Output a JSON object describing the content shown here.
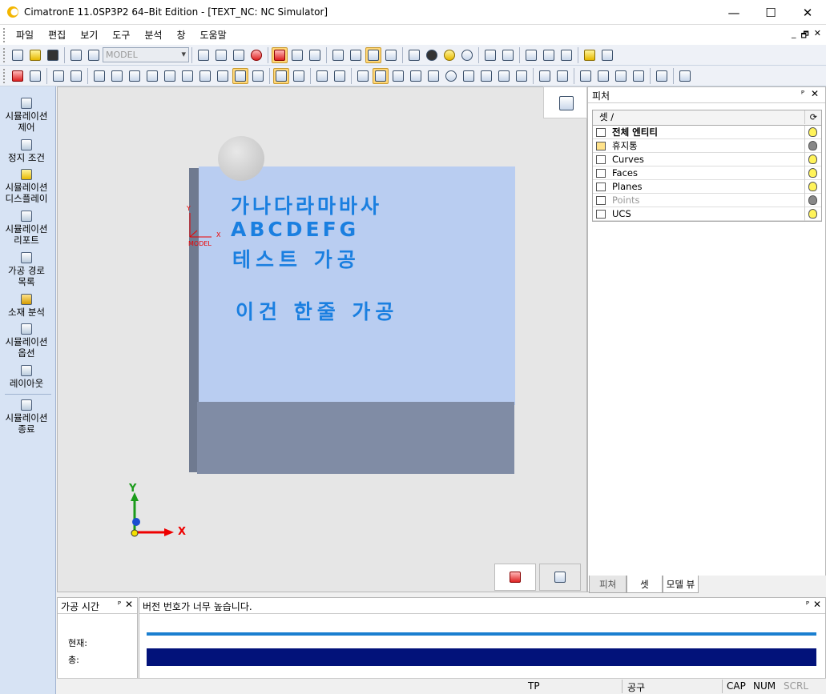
{
  "window": {
    "title": "CimatronE 11.0SP3P2 64–Bit Edition - [TEXT_NC: NC Simulator]",
    "minimize": "—",
    "maximize": "☐",
    "close": "✕"
  },
  "menu": [
    "파일",
    "편집",
    "보기",
    "도구",
    "분석",
    "창",
    "도움말"
  ],
  "mdi_controls": [
    "_",
    "🗗",
    "✕"
  ],
  "toolbar": {
    "model_combo": "MODEL"
  },
  "leftbar": {
    "items": [
      {
        "label": "시뮬레이션\n제어",
        "icon": "simulation-control-icon"
      },
      {
        "label": "정지 조건",
        "icon": "stop-condition-icon"
      },
      {
        "label": "시뮬레이션\n디스플레이",
        "icon": "simulation-display-icon"
      },
      {
        "label": "시뮬레이션\n리포트",
        "icon": "simulation-report-icon"
      },
      {
        "label": "가공 경로\n목록",
        "icon": "toolpath-list-icon"
      },
      {
        "label": "소재 분석",
        "icon": "stock-analysis-icon"
      },
      {
        "label": "시뮬레이션\n옵션",
        "icon": "simulation-options-icon"
      },
      {
        "label": "레이아웃",
        "icon": "layout-icon"
      },
      {
        "label": "시뮬레이션\n종료",
        "icon": "simulation-exit-icon"
      }
    ]
  },
  "viewport": {
    "text_lines": [
      "가나다라마바사",
      "ABCDEFG",
      "테스트 가공",
      "이건 한줄 가공"
    ],
    "ucs_label": "MODEL",
    "axis_x": "X",
    "axis_y": "Y",
    "small_axis_x": "X",
    "small_axis_y": "Y"
  },
  "right_panel": {
    "title": "피처",
    "pin": "ᴾ",
    "close": "✕",
    "column_header": "셋 /",
    "rows": [
      {
        "name": "전체 엔티티",
        "bold": true,
        "bulb": "#fff35a"
      },
      {
        "name": "휴지통",
        "bold": false,
        "bulb": "#888888"
      },
      {
        "name": "Curves",
        "bold": false,
        "bulb": "#fff35a"
      },
      {
        "name": "Faces",
        "bold": false,
        "bulb": "#fff35a"
      },
      {
        "name": "Planes",
        "bold": false,
        "bulb": "#fff35a"
      },
      {
        "name": "Points",
        "bold": false,
        "bulb": "#888888",
        "dim": true
      },
      {
        "name": "UCS",
        "bold": false,
        "bulb": "#fff35a"
      }
    ],
    "tabs": [
      "피쳐",
      "셋",
      "모델 뷰"
    ],
    "selected_tab": 1
  },
  "bottom": {
    "left_title": "가공 시간",
    "right_title": "버전 번호가 너무 높습니다.",
    "current_label": "현재:",
    "total_label": "총:",
    "current_progress": 1.0,
    "total_progress": 1.0
  },
  "status": {
    "tp": "TP",
    "tool": "공구",
    "cap": "CAP",
    "num": "NUM",
    "scrl": "SCRL"
  },
  "colors": {
    "engrave_text": "#1a7fe0",
    "progress_current": "#1a7fd0",
    "progress_total": "#02127a"
  }
}
